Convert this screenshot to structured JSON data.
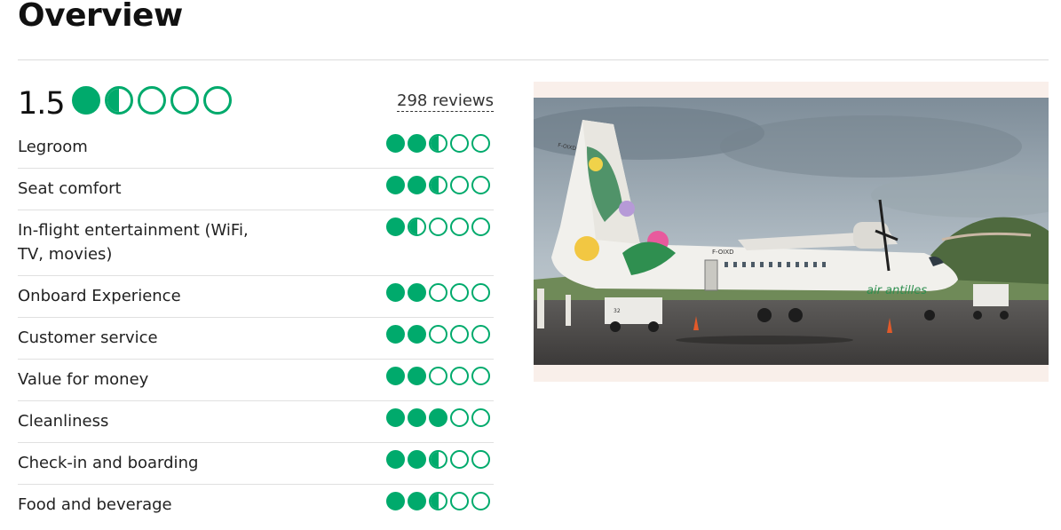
{
  "page": {
    "title": "Overview"
  },
  "overall": {
    "rating_text": "1.5",
    "rating_value": 1.5,
    "max_rating": 5,
    "reviews_label": "298 reviews"
  },
  "subratings": [
    {
      "label": "Legroom",
      "value": 2.5
    },
    {
      "label": "Seat comfort",
      "value": 2.5
    },
    {
      "label": "In-flight entertainment (WiFi, TV, movies)",
      "value": 1.5
    },
    {
      "label": "Onboard Experience",
      "value": 2
    },
    {
      "label": "Customer service",
      "value": 2
    },
    {
      "label": "Value for money",
      "value": 2
    },
    {
      "label": "Cleanliness",
      "value": 3
    },
    {
      "label": "Check-in and boarding",
      "value": 2.5
    },
    {
      "label": "Food and beverage",
      "value": 2.5
    }
  ],
  "photo": {
    "tail_registration": "F-OIXD",
    "body_registration": "F-OIXD",
    "brand": "air antilles",
    "stand_number": "32"
  },
  "colors": {
    "accent": "#00aa6c",
    "photo_frame": "#f9efea"
  }
}
